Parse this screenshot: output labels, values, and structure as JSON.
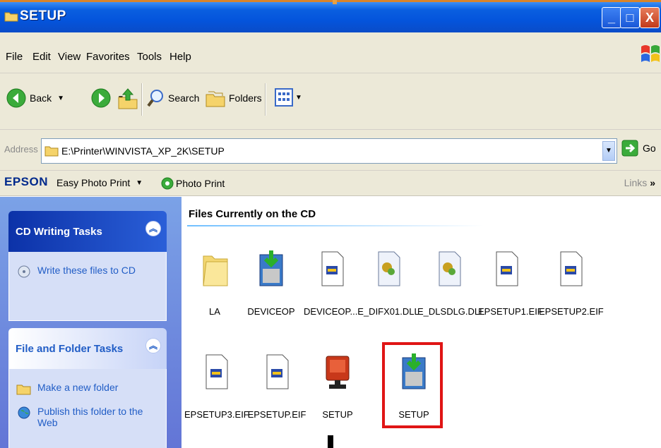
{
  "window": {
    "title": "SETUP"
  },
  "menu": [
    "File",
    "Edit",
    "View",
    "Favorites",
    "Tools",
    "Help"
  ],
  "toolbar": {
    "back": "Back",
    "search": "Search",
    "folders": "Folders"
  },
  "address": {
    "label": "Address",
    "path": "E:\\Printer\\WINVISTA_XP_2K\\SETUP",
    "go": "Go"
  },
  "epson": {
    "brand": "EPSON",
    "easy_photo_print": "Easy Photo Print",
    "photo_print": "Photo Print",
    "links": "Links"
  },
  "tasks": {
    "cd_writing": {
      "title": "CD Writing Tasks",
      "items": [
        "Write these files to CD"
      ]
    },
    "file_folder": {
      "title": "File and Folder Tasks",
      "items": [
        "Make a new folder",
        "Publish this folder to the Web"
      ]
    }
  },
  "main": {
    "section_title": "Files Currently on the CD",
    "files": [
      {
        "name": "LA",
        "icon": "folder-icon"
      },
      {
        "name": "DEVICEOP",
        "icon": "installer-icon"
      },
      {
        "name": "DEVICEOP....",
        "icon": "eif-file-icon"
      },
      {
        "name": "E_DIFX01.DLL",
        "icon": "dll-file-icon"
      },
      {
        "name": "E_DLSDLG.DLL",
        "icon": "dll-file-icon"
      },
      {
        "name": "EPSETUP1.EIF",
        "icon": "eif-file-icon"
      },
      {
        "name": "EPSETUP2.EIF",
        "icon": "eif-file-icon"
      },
      {
        "name": "EPSETUP3.EIF",
        "icon": "eif-file-icon"
      },
      {
        "name": "EPSETUP.EIF",
        "icon": "eif-file-icon"
      },
      {
        "name": "SETUP",
        "icon": "setup-exe-icon"
      },
      {
        "name": "SETUP",
        "icon": "installer-icon",
        "highlighted": true
      }
    ]
  },
  "colors": {
    "titlebar": "#0454dc",
    "highlight": "#e01515",
    "taskpane": "#6f8fe0"
  }
}
